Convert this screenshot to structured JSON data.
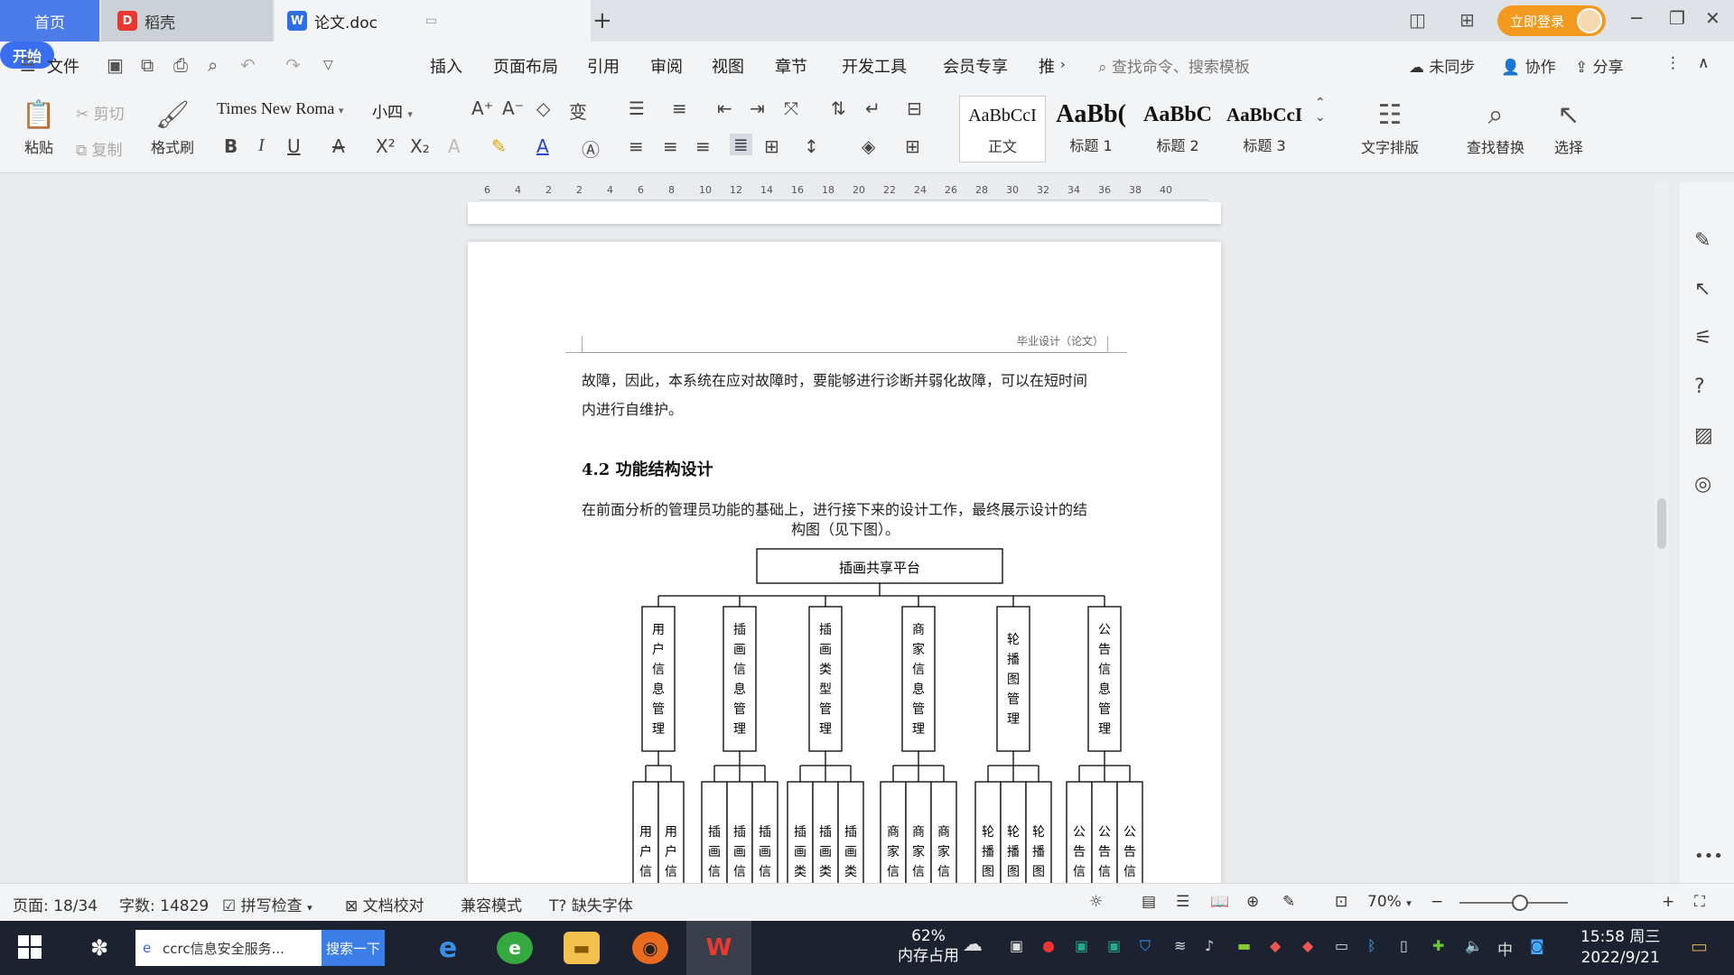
{
  "titlebar": {
    "tab_home": "首页",
    "tab_daoke": "稻壳",
    "tab_doc": "论文.doc",
    "login": "立即登录"
  },
  "menu": {
    "file": "文件",
    "start": "开始",
    "items": [
      "插入",
      "页面布局",
      "引用",
      "审阅",
      "视图",
      "章节",
      "开发工具",
      "会员专享",
      "推"
    ],
    "search_cmd": "查找命令、搜索模板",
    "unsynced": "未同步",
    "collab": "协作",
    "share": "分享"
  },
  "ribbon": {
    "paste": "粘贴",
    "cut": "剪切",
    "copy": "复制",
    "format_painter": "格式刷",
    "font_name": "Times New Roma",
    "font_size": "小四",
    "styles": [
      {
        "sample": "AaBbCcI",
        "name": "正文"
      },
      {
        "sample": "AaBb(",
        "name": "标题 1"
      },
      {
        "sample": "AaBbC",
        "name": "标题 2"
      },
      {
        "sample": "AaBbCcI",
        "name": "标题 3"
      }
    ],
    "text_layout": "文字排版",
    "find_replace": "查找替换",
    "select": "选择"
  },
  "ruler": [
    "6",
    "4",
    "2",
    "2",
    "4",
    "6",
    "8",
    "10",
    "12",
    "14",
    "16",
    "18",
    "20",
    "22",
    "24",
    "26",
    "28",
    "30",
    "32",
    "34",
    "36",
    "38",
    "40"
  ],
  "document": {
    "header": "毕业设计（论文）",
    "para1_line1": "故障，因此，本系统在应对故障时，要能够进行诊断并弱化故障，可以在短时间",
    "para1_line2": "内进行自维护。",
    "heading": "4.2  功能结构设计",
    "para2_line1": "在前面分析的管理员功能的基础上，进行接下来的设计工作，最终展示设计的结",
    "para2_line2": "构图（见下图）。",
    "org_chart": {
      "root": "插画共享平台",
      "modules": [
        {
          "name": "用户信息管理",
          "children": [
            "用户信息新",
            "用户信息修"
          ]
        },
        {
          "name": "插画信息管理",
          "children": [
            "插画信息添",
            "插画信息删",
            "插画信息修"
          ]
        },
        {
          "name": "插画类型管理",
          "children": [
            "插画类型添",
            "插画类型修",
            "插画类型删"
          ]
        },
        {
          "name": "商家信息管理",
          "children": [
            "商家信息修",
            "商家信息删",
            "商家信息添"
          ]
        },
        {
          "name": "轮播图管理",
          "children": [
            "轮播图删改",
            "轮播图删除",
            "轮播图添加"
          ]
        },
        {
          "name": "公告信息管理",
          "children": [
            "公告信息修改",
            "公告信息删除",
            "公告信息添加"
          ]
        }
      ]
    }
  },
  "statusbar": {
    "page": "页面: 18/34",
    "words": "字数: 14829",
    "spell": "拼写检查",
    "proof": "文档校对",
    "compat": "兼容模式",
    "missing_font": "缺失字体",
    "zoom": "70%"
  },
  "taskbar": {
    "search_text": "ccrc信息安全服务...",
    "search_go": "搜索一下",
    "mem_percent": "62%",
    "mem_label": "内存占用",
    "ime": "中",
    "time": "15:58 周三",
    "date": "2022/9/21"
  },
  "colors": {
    "accent": "#3a6ef0",
    "home_tab": "#4a7be8",
    "login": "#f39a1e",
    "taskbar": "#1c2230"
  }
}
